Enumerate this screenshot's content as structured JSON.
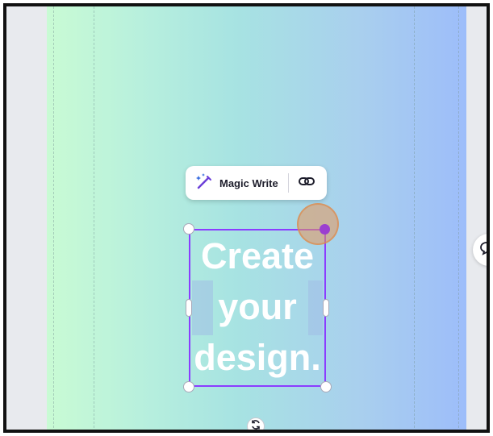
{
  "toolbar": {
    "magic_write_label": "Magic Write",
    "magic_write_icon": "magic-wand-icon",
    "link_icon": "link-icon"
  },
  "text_element": {
    "lines": [
      "Create",
      "your",
      "design."
    ],
    "color": "#ffffff"
  },
  "selection": {
    "border_color": "#8b3dff"
  },
  "canvas": {
    "gradient_start": "#c9fbd4",
    "gradient_end": "#9dbdfa"
  },
  "controls": {
    "rotate_icon": "rotate-icon",
    "comment_icon": "comment-icon"
  }
}
